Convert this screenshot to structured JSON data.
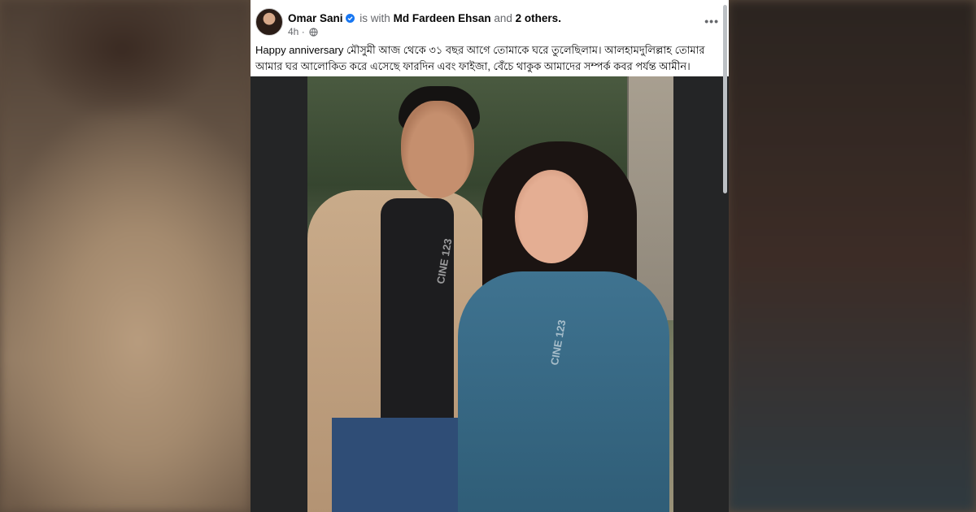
{
  "post": {
    "author": "Omar Sani",
    "is_with_text": "is with",
    "tagged_person": "Md Fardeen Ehsan",
    "and_text": "and",
    "others": "2 others.",
    "time": "4h",
    "meta_separator": "·",
    "more_label": "•••",
    "text_line1": "Happy anniversary মৌসুমী আজ থেকে ৩১ বছর আগে তোমাকে ঘরে তুলেছিলাম। আলহামদুলিল্লাহ তোমার",
    "text_line2": "আমার ঘর আলোকিত করে এসেছে ফারদিন এবং ফাইজা, বেঁচে থাকুক আমাদের সম্পর্ক কবর পর্যন্ত আমীন।",
    "watermark": "CINE 123"
  },
  "colors": {
    "verified": "#1877f2",
    "card_background": "#ffffff",
    "photo_frame": "#242526"
  },
  "icons": {
    "verified": "verified-badge-icon",
    "privacy": "globe-icon",
    "more": "more-options-icon"
  }
}
